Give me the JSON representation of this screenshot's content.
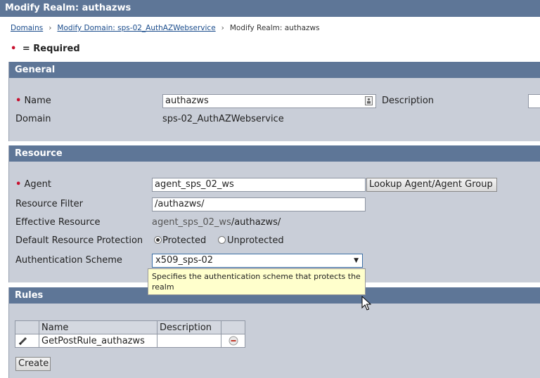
{
  "window": {
    "title": "Modify Realm: authazws"
  },
  "breadcrumb": {
    "items": [
      "Domains",
      "Modify Domain: sps-02_AuthAZWebservice"
    ],
    "current": "Modify Realm: authazws",
    "separator": "›"
  },
  "required_note": {
    "marker": "•",
    "text": "= Required"
  },
  "general": {
    "header": "General",
    "name_label": "Name",
    "name_value": "authazws",
    "description_label": "Description",
    "domain_label": "Domain",
    "domain_value": "sps-02_AuthAZWebservice"
  },
  "resource": {
    "header": "Resource",
    "agent_label": "Agent",
    "agent_value": "agent_sps_02_ws",
    "lookup_button": "Lookup Agent/Agent Group",
    "filter_label": "Resource Filter",
    "filter_value": "/authazws/",
    "effective_label": "Effective Resource",
    "effective_agent": "agent_sps_02_ws",
    "effective_path": "/authazws/",
    "protection_label": "Default Resource Protection",
    "protected_label": "Protected",
    "unprotected_label": "Unprotected",
    "protection_selected": "Protected",
    "scheme_label": "Authentication Scheme",
    "scheme_value": "x509_sps-02",
    "scheme_tooltip": "Specifies the authentication scheme that protects the realm"
  },
  "rules": {
    "header": "Rules",
    "columns": [
      "Name",
      "Description"
    ],
    "rows": [
      {
        "name": "GetPostRule_authazws",
        "description": ""
      }
    ],
    "create_button": "Create"
  },
  "colors": {
    "header_bg": "#5e7697",
    "panel_bg": "#c9ced8",
    "required_dot": "#c8102e",
    "tooltip_bg": "#ffffcc"
  },
  "icons": [
    "pencil-icon",
    "remove-icon",
    "field-picker-icon",
    "dropdown-arrow-icon",
    "mouse-cursor-icon"
  ]
}
